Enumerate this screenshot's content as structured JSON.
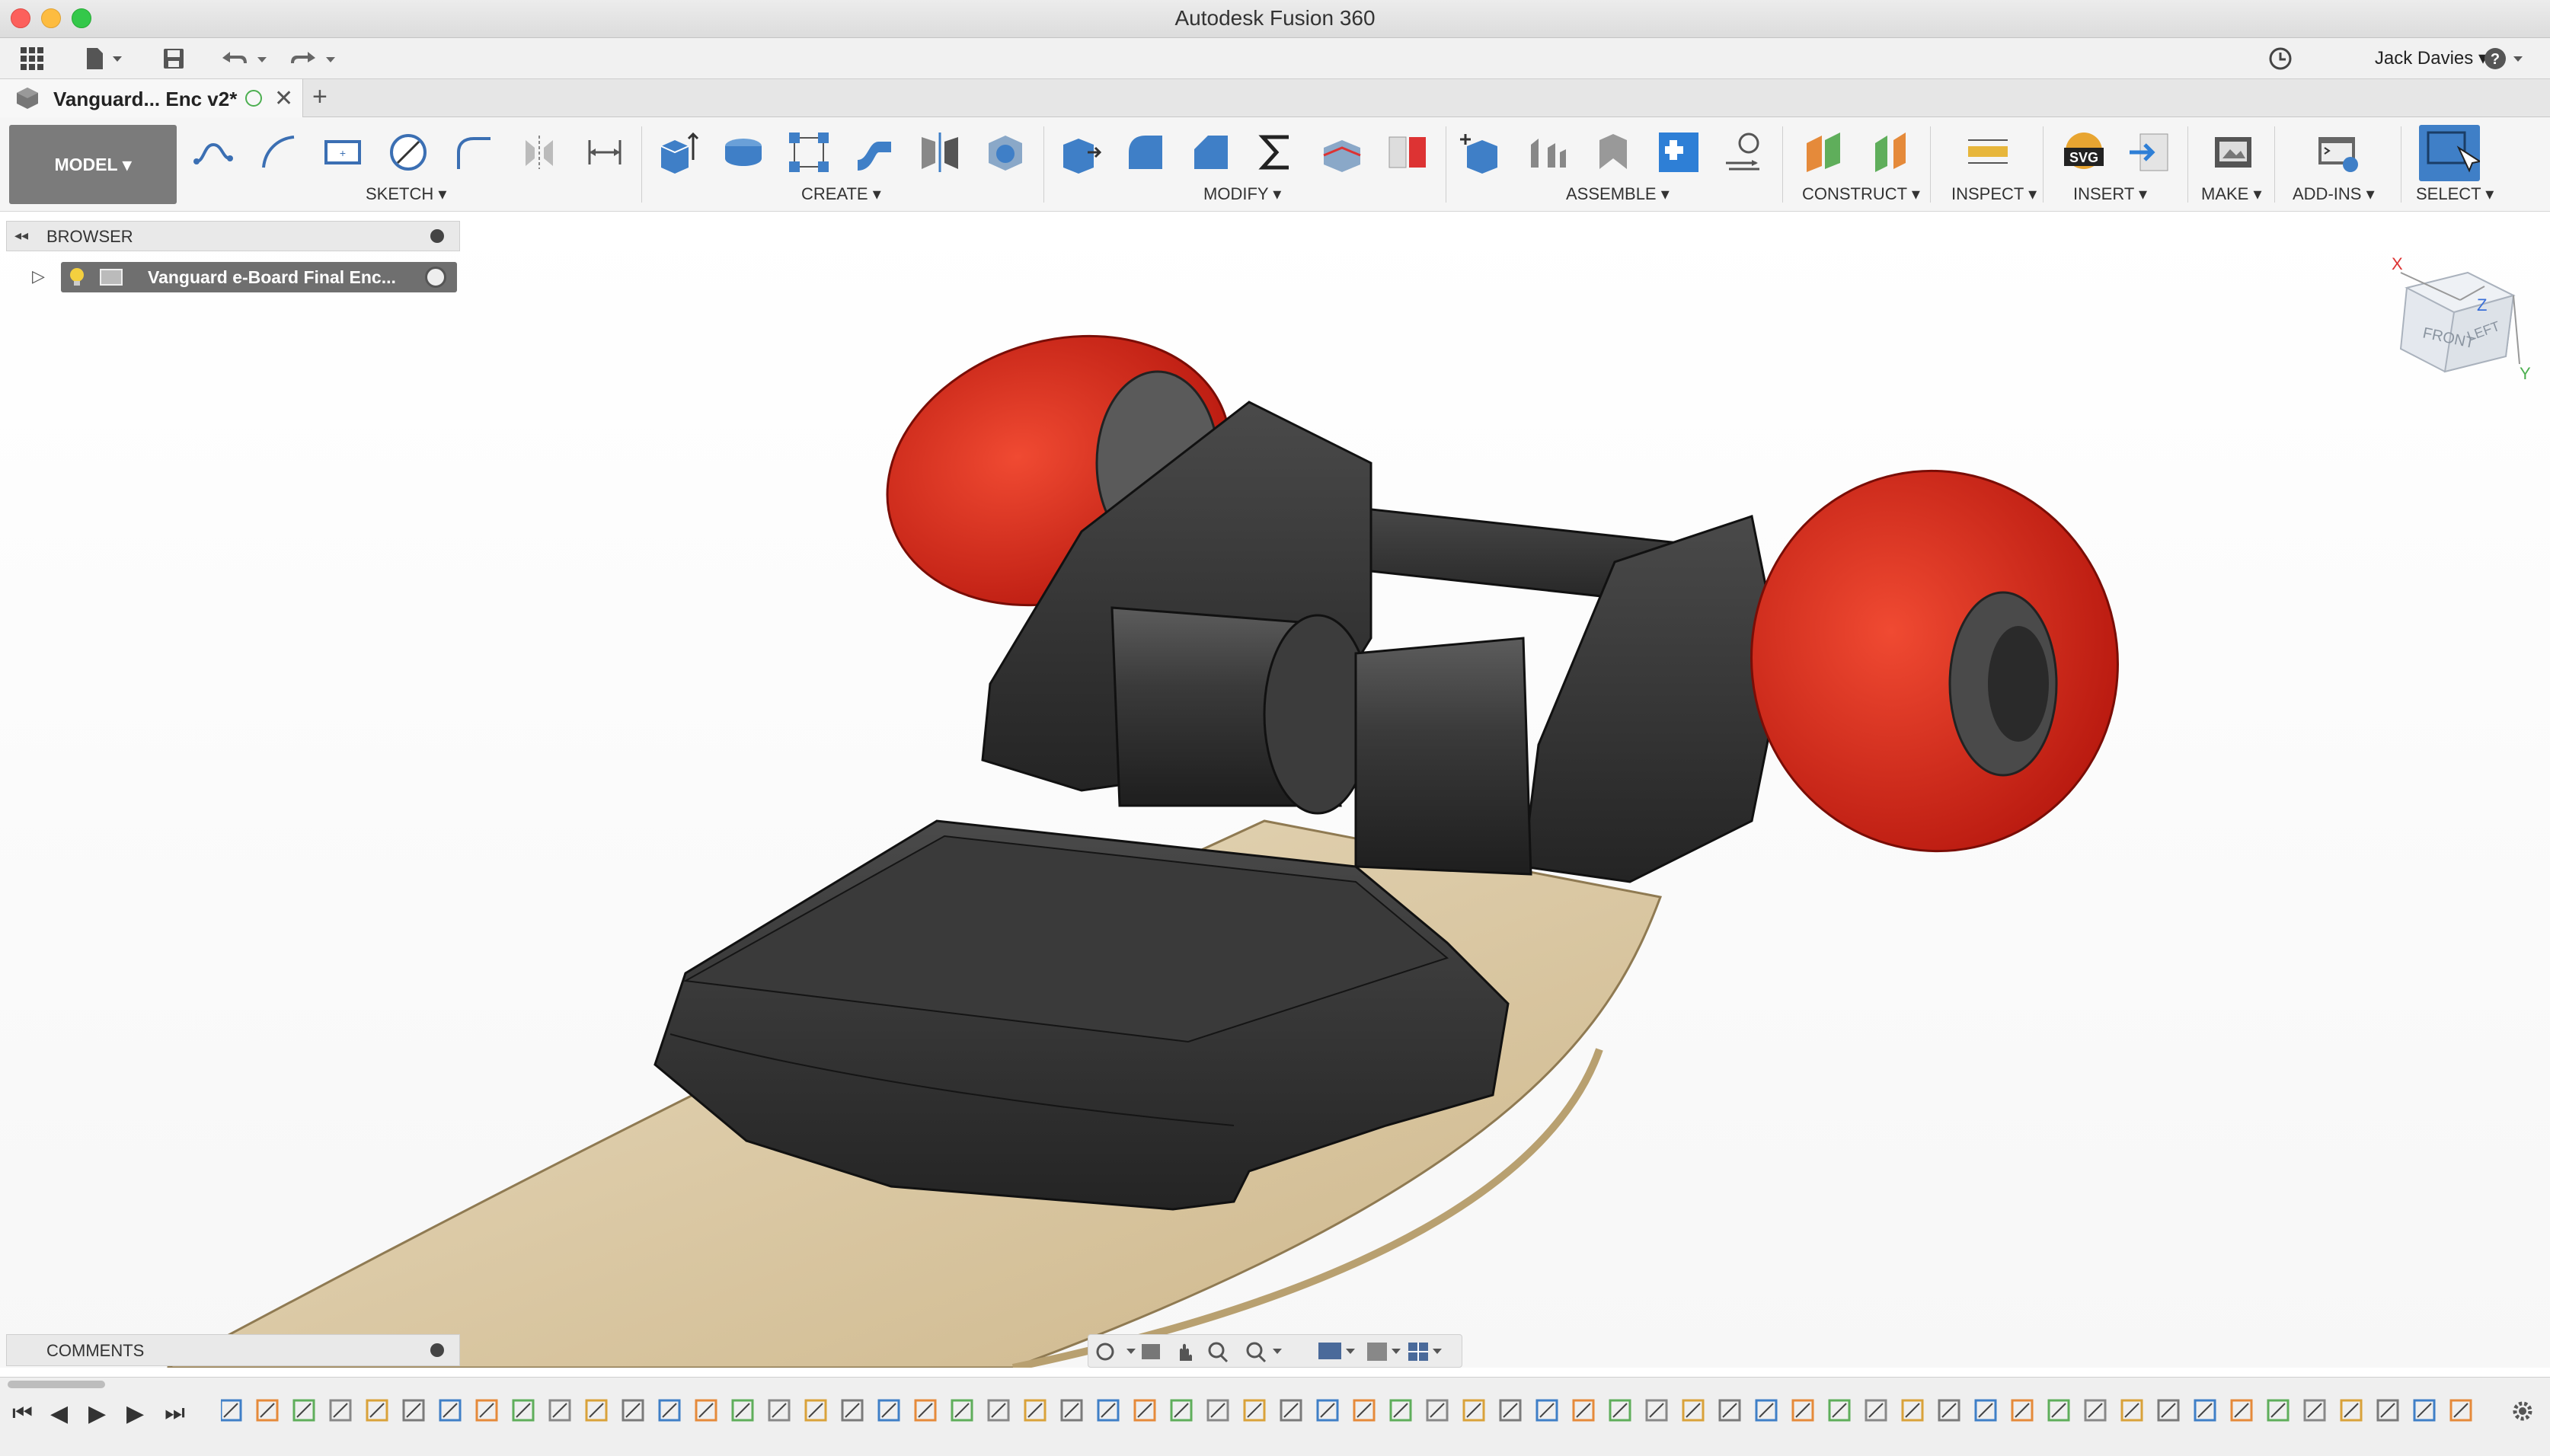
{
  "window": {
    "title": "Autodesk Fusion 360"
  },
  "app_toolbar": {
    "user_name": "Jack Davies",
    "help_label": "?"
  },
  "document_tab": {
    "label": "Vanguard... Enc v2*",
    "add_tab_label": "+"
  },
  "ribbon": {
    "workspace_label": "MODEL",
    "groups": {
      "sketch": "SKETCH",
      "create": "CREATE",
      "modify": "MODIFY",
      "assemble": "ASSEMBLE",
      "construct": "CONSTRUCT",
      "inspect": "INSPECT",
      "insert": "INSERT",
      "make": "MAKE",
      "addins": "ADD-INS",
      "select": "SELECT"
    },
    "svg_icon_text": "SVG"
  },
  "browser": {
    "title": "BROWSER",
    "root_node_label": "Vanguard e-Board Final Enc..."
  },
  "comments": {
    "title": "COMMENTS"
  },
  "viewcube": {
    "front_label": "FRONT",
    "left_label": "LEFT",
    "x_axis": "X",
    "z_axis": "Z",
    "y_axis": "Y"
  },
  "colors": {
    "wheel_red": "#d8271b",
    "deck_wood": "#d9c7a0",
    "enclosure_dark": "#3a3a3a",
    "accent_blue": "#3a7fc4"
  }
}
